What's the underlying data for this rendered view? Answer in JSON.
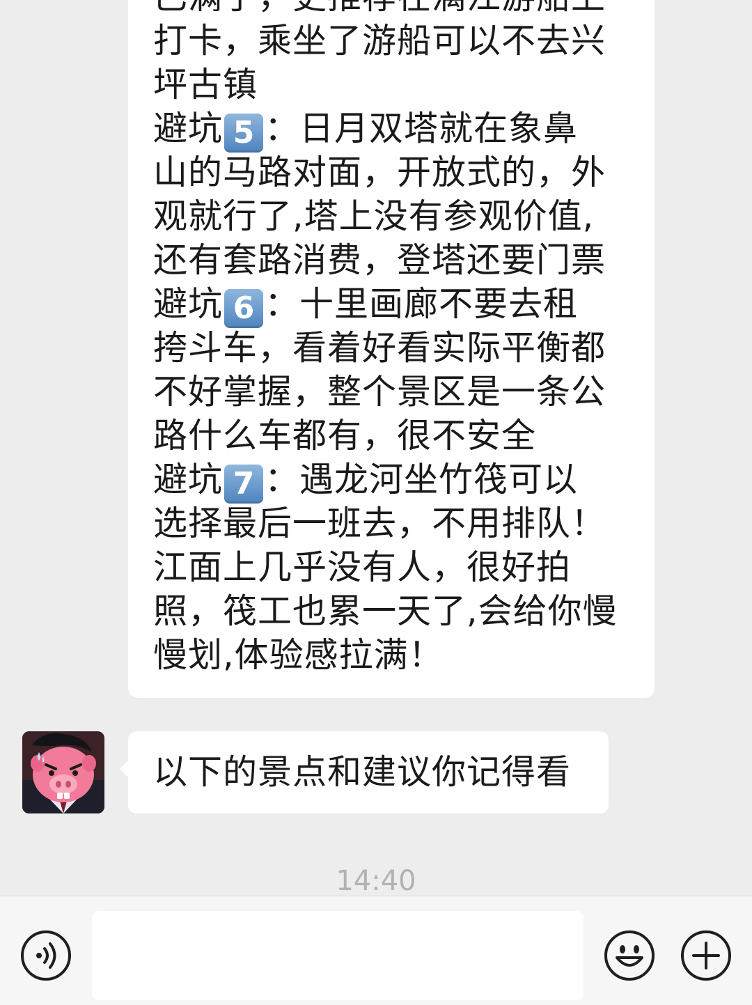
{
  "chat": {
    "message_lines": [
      "已满了，更推荐在漓江游船上",
      "打卡，乘坐了游船可以不去兴",
      "坪古镇",
      {
        "pre": "避坑",
        "num": "5",
        "post": "：日月双塔就在象鼻"
      },
      "山的马路对面，开放式的，外",
      "观就行了,塔上没有参观价值,",
      "还有套路消费，登塔还要门票",
      {
        "pre": "避坑",
        "num": "6",
        "post": "：十里画廊不要去租"
      },
      "挎斗车，看着好看实际平衡都",
      "不好掌握，整个景区是一条公",
      "路什么车都有，很不安全",
      {
        "pre": "避坑",
        "num": "7",
        "post": "：遇龙河坐竹筏可以"
      },
      "选择最后一班去，不用排队！",
      "江面上几乎没有人，很好拍",
      "照，筏工也累一天了,会给你慢",
      "慢划,体验感拉满！"
    ],
    "second_message": "以下的景点和建议你记得看",
    "timestamp": "14:40"
  },
  "input": {
    "value": "",
    "placeholder": ""
  },
  "icons": {
    "voice": "voice-icon",
    "emoji": "emoji-icon",
    "plus": "plus-icon",
    "avatar": "avatar-pig-cartoon"
  },
  "colors": {
    "background": "#ededed",
    "bubble": "#ffffff",
    "text": "#1a1a1a",
    "timestamp": "#b2b2b2",
    "keycap": "#5b8ec9"
  }
}
